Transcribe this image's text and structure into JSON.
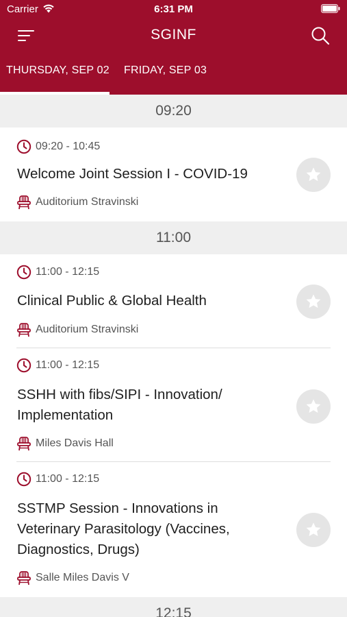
{
  "status_bar": {
    "carrier": "Carrier",
    "time": "6:31 PM"
  },
  "nav": {
    "title": "SGINF"
  },
  "tabs": [
    {
      "label": "THURSDAY, SEP 02",
      "selected": true
    },
    {
      "label": "FRIDAY, SEP 03",
      "selected": false
    }
  ],
  "colors": {
    "brand": "#9d0e2c",
    "accent": "#9d0e2c",
    "section_bg": "#efefef",
    "star_bg": "#e5e5e5"
  },
  "time_groups": [
    {
      "label": "09:20",
      "sessions": [
        {
          "time": "09:20 - 10:45",
          "title": "Welcome Joint Session I - COVID-19",
          "location": "Auditorium Stravinski"
        }
      ]
    },
    {
      "label": "11:00",
      "sessions": [
        {
          "time": "11:00 - 12:15",
          "title": "Clinical Public & Global Health",
          "location": "Auditorium Stravinski"
        },
        {
          "time": "11:00 - 12:15",
          "title": "SSHH with fibs/SIPI - Innovation/ Implementation",
          "location": "Miles Davis Hall"
        },
        {
          "time": "11:00 - 12:15",
          "title": "SSTMP Session - Innovations in Veterinary Parasitology (Vaccines, Diagnostics, Drugs)",
          "location": "Salle Miles Davis V"
        }
      ]
    },
    {
      "label": "12:15",
      "sessions": []
    }
  ]
}
